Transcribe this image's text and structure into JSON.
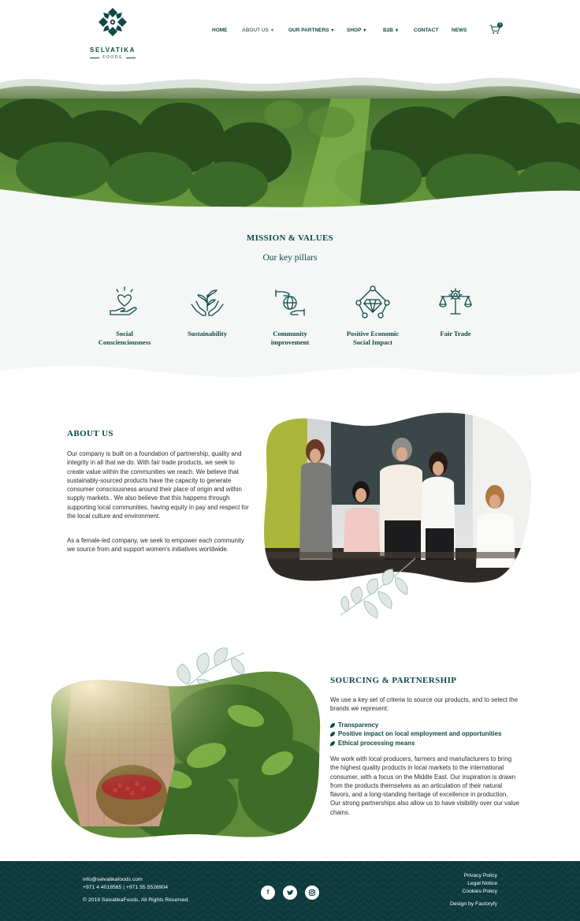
{
  "brand": {
    "name": "SELVATIKA",
    "subname": "FOODS"
  },
  "nav": {
    "items": [
      {
        "label": "HOME",
        "dropdown": false
      },
      {
        "label": "ABOUT US",
        "dropdown": true,
        "active": true
      },
      {
        "label": "OUR PARTNERS",
        "dropdown": true
      },
      {
        "label": "SHOP",
        "dropdown": true
      },
      {
        "label": "B2B",
        "dropdown": true
      },
      {
        "label": "CONTACT",
        "dropdown": false
      },
      {
        "label": "NEWS",
        "dropdown": false
      }
    ],
    "cart_count": "0",
    "cart_icon": "shopping-cart-icon"
  },
  "mission": {
    "title": "MISSION & VALUES",
    "subtitle": "Our key pillars",
    "pillars": [
      {
        "label_line1": "Social",
        "label_line2": "Conscienciousness",
        "icon": "heart-hand-icon"
      },
      {
        "label_line1": "Sustainability",
        "label_line2": "",
        "icon": "plant-hands-icon"
      },
      {
        "label_line1": "Community",
        "label_line2": "improvement",
        "icon": "globe-hands-icon"
      },
      {
        "label_line1": "Positive Economic",
        "label_line2": "Social Impact",
        "icon": "diamond-network-icon"
      },
      {
        "label_line1": "Fair Trade",
        "label_line2": "",
        "icon": "scale-gear-icon"
      }
    ]
  },
  "about": {
    "title": "ABOUT US",
    "paragraph1": "Our company is built on a foundation of partnership, quality and integrity in all that we do. With fair trade products, we seek to create value within the communities we reach. We believe that sustainably-sourced products have the capacity to generate consumer consciousness around their place of origin and within supply markets.. We also believe that this happens through supporting local communities, having equity in pay and respect for the local culture and environment.",
    "paragraph2": "As a female-led company, we seek to empower each community we source from and support women's initiatives worldwide."
  },
  "sourcing": {
    "title": "SOURCING & PARTNERSHIP",
    "intro": "We use a key set of criteria to source our products, and to select the brands we represent:",
    "criteria": [
      "Transparency",
      "Positive impact on local employment and opportunities",
      "Ethical processing means"
    ],
    "body": "We work with local producers, farmers and manufacturers to bring the highest quality products in local markets to the international consumer, with a focus on the Middle East. Our inspiration is drawn from the products themselves as an articulation of their natural flavors, and a long-standing heritage of excellence in production. Our strong partnerships also allow us to have visibility over our value chains."
  },
  "footer": {
    "email": "info@selvatikafoods.com",
    "phone": "+971 4 4018565 | +971 55 5526904",
    "copyright": "© 2019 SelvatikaFoods. All Rights Reserved.",
    "links": [
      "Privacy Policy",
      "Legal Notice",
      "Cookies Policy"
    ],
    "credit": "Design by Factoryfy",
    "social": [
      {
        "label": "f",
        "icon": "facebook-icon"
      },
      {
        "label": "t",
        "icon": "twitter-icon"
      },
      {
        "label": "ig",
        "icon": "instagram-icon"
      }
    ]
  },
  "colors": {
    "brand_green": "#0d4a45",
    "footer_bg": "#0d3a3c",
    "mission_bg": "#f4f7f6"
  }
}
